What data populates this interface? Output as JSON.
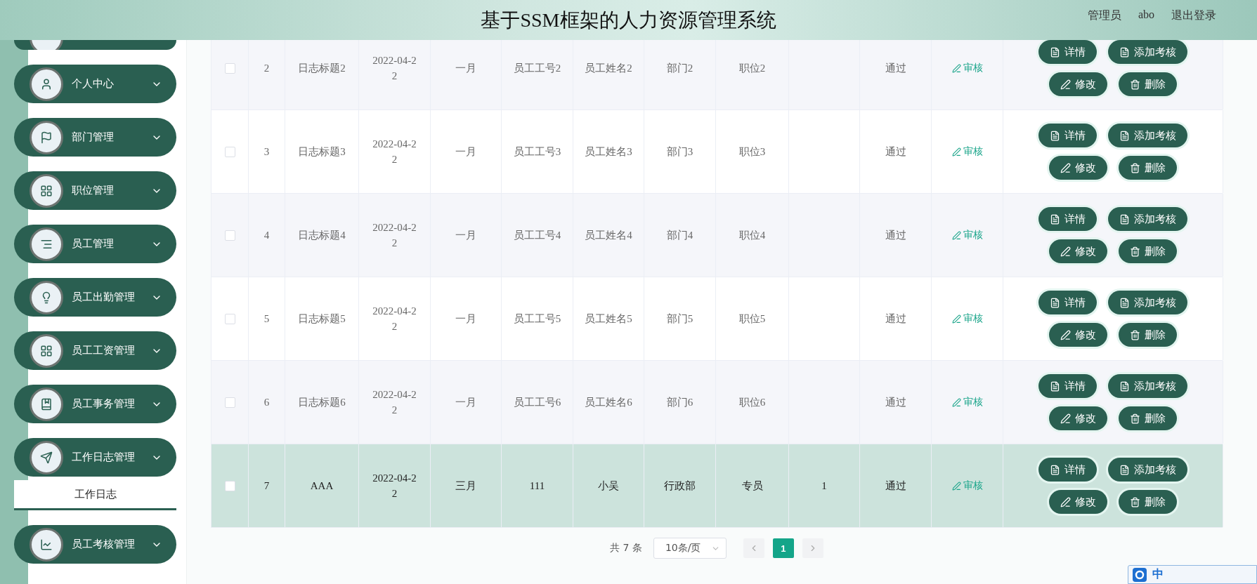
{
  "header": {
    "title": "基于SSM框架的人力资源管理系统",
    "role": "管理员",
    "username": "abo",
    "logout": "退出登录"
  },
  "sidebar": {
    "items": [
      {
        "label": "个人中心"
      },
      {
        "label": "部门管理"
      },
      {
        "label": "职位管理"
      },
      {
        "label": "员工管理"
      },
      {
        "label": "员工出勤管理"
      },
      {
        "label": "员工工资管理"
      },
      {
        "label": "员工事务管理"
      },
      {
        "label": "工作日志管理",
        "children": [
          {
            "label": "工作日志",
            "selected": true
          }
        ]
      },
      {
        "label": "员工考核管理"
      }
    ]
  },
  "table": {
    "rows": [
      {
        "checked": false,
        "highlighted": false,
        "index": "2",
        "title": "日志标题2",
        "date": "2022-04-22",
        "month": "一月",
        "employee_no": "员工工号2",
        "employee_name": "员工姓名2",
        "department": "部门2",
        "position": "职位2",
        "status": "通过",
        "review": "审核",
        "actions": [
          "详情",
          "添加考核",
          "修改",
          "删除"
        ]
      },
      {
        "checked": false,
        "highlighted": false,
        "index": "3",
        "title": "日志标题3",
        "date": "2022-04-22",
        "month": "一月",
        "employee_no": "员工工号3",
        "employee_name": "员工姓名3",
        "department": "部门3",
        "position": "职位3",
        "status": "通过",
        "review": "审核",
        "actions": [
          "详情",
          "添加考核",
          "修改",
          "删除"
        ]
      },
      {
        "checked": false,
        "highlighted": false,
        "index": "4",
        "title": "日志标题4",
        "date": "2022-04-22",
        "month": "一月",
        "employee_no": "员工工号4",
        "employee_name": "员工姓名4",
        "department": "部门4",
        "position": "职位4",
        "status": "通过",
        "review": "审核",
        "actions": [
          "详情",
          "添加考核",
          "修改",
          "删除"
        ]
      },
      {
        "checked": false,
        "highlighted": false,
        "index": "5",
        "title": "日志标题5",
        "date": "2022-04-22",
        "month": "一月",
        "employee_no": "员工工号5",
        "employee_name": "员工姓名5",
        "department": "部门5",
        "position": "职位5",
        "status": "通过",
        "review": "审核",
        "actions": [
          "详情",
          "添加考核",
          "修改",
          "删除"
        ]
      },
      {
        "checked": false,
        "highlighted": false,
        "index": "6",
        "title": "日志标题6",
        "date": "2022-04-22",
        "month": "一月",
        "employee_no": "员工工号6",
        "employee_name": "员工姓名6",
        "department": "部门6",
        "position": "职位6",
        "status": "通过",
        "review": "审核",
        "actions": [
          "详情",
          "添加考核",
          "修改",
          "删除"
        ]
      },
      {
        "checked": false,
        "highlighted": true,
        "index": "7",
        "title": "AAA",
        "date": "2022-04-22",
        "month": "三月",
        "employee_no": "111",
        "employee_name": "小吴",
        "department": "行政部",
        "position": "专员",
        "column_10": "1",
        "status": "通过",
        "review": "审核",
        "actions": [
          "详情",
          "添加考核",
          "修改",
          "删除"
        ]
      }
    ]
  },
  "pagination": {
    "total": "共 7 条",
    "page_size": "10条/页",
    "pages": [
      {
        "label": "1",
        "selected": true
      }
    ]
  },
  "ime_bar": {
    "mode": "中"
  }
}
